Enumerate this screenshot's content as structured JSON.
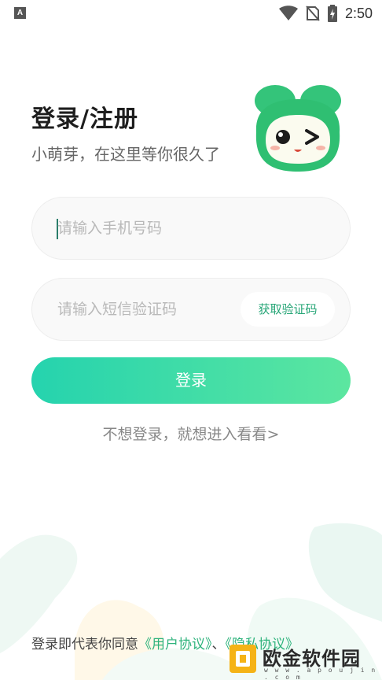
{
  "status_bar": {
    "app_icon_letter": "A",
    "time": "2:50"
  },
  "header": {
    "title": "登录/注册",
    "subtitle": "小萌芽，在这里等你很久了"
  },
  "form": {
    "phone": {
      "placeholder": "请输入手机号码",
      "value": ""
    },
    "code": {
      "placeholder": "请输入短信验证码",
      "value": ""
    },
    "get_code_label": "获取验证码",
    "login_label": "登录"
  },
  "guest_link": "不想登录，就想进入看看>",
  "agreement": {
    "prefix": "登录即代表你同意",
    "user_agreement": "《用户协议》",
    "separator": "、",
    "privacy_agreement": "《隐私协议》"
  },
  "watermark": {
    "text": "欧金软件园",
    "url": "w w w . a p o u j i n . c o m"
  },
  "colors": {
    "accent": "#2eb37c",
    "button_gradient_start": "#25d3ae",
    "button_gradient_end": "#5ce6a0",
    "mascot_green": "#2fbf72"
  }
}
